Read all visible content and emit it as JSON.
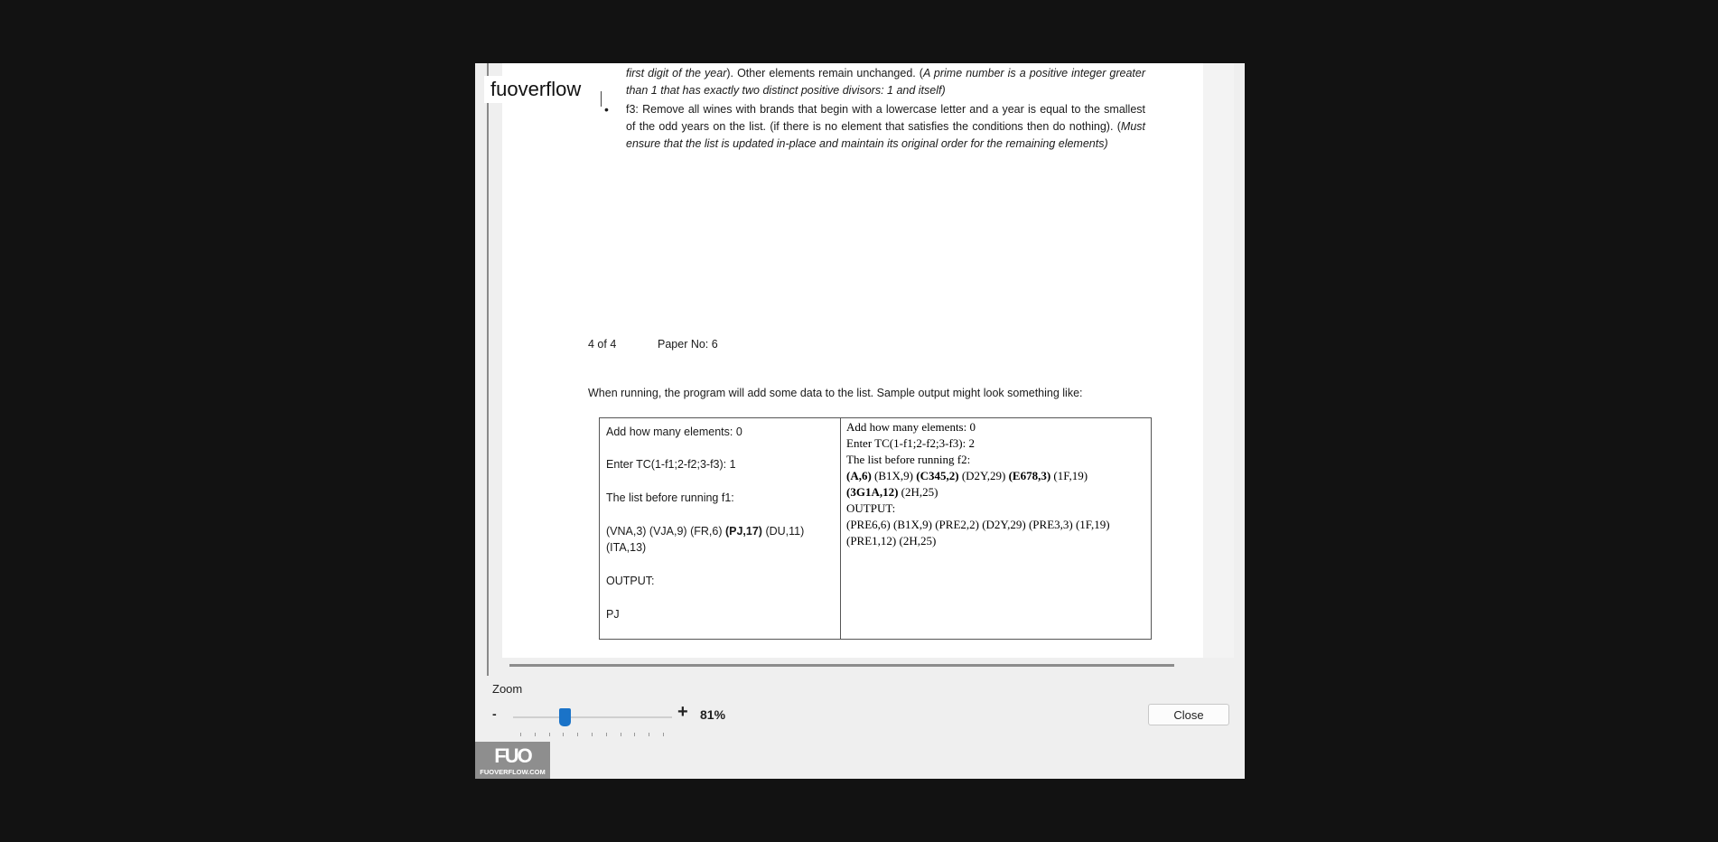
{
  "watermark": {
    "text": "fuoverflow"
  },
  "document": {
    "para1_parts": [
      {
        "text": "first digit of the year",
        "italic": true
      },
      {
        "text": "). Other elements remain unchanged. (",
        "italic": false
      },
      {
        "text": "A prime number is a positive integer greater than 1 that has exactly two distinct positive divisors: 1 and itself)",
        "italic": true
      }
    ],
    "bullet_f3_parts": [
      {
        "text": "f3: Remove all wines with brands that begin with a lowercase letter and a year is equal to the smallest of the odd years on the list. (if there is no element that satisfies the conditions then do nothing). (",
        "italic": false
      },
      {
        "text": "Must ensure that the list is updated in-place and maintain its original order for the remaining elements)",
        "italic": true
      }
    ],
    "bullet_symbol": "•",
    "page_indicator": "4 of 4",
    "paper_no": "Paper No: 6",
    "intro": "When running, the program will add  some data to the list. Sample output might look something like:",
    "left_cell": {
      "line1": "Add how many elements: 0",
      "line2": "Enter TC(1-f1;2-f2;3-f3): 1",
      "line3": "The list before running f1:",
      "line4_parts": [
        {
          "text": "(VNA,3) (VJA,9) (FR,6) ",
          "bold": false
        },
        {
          "text": "(PJ,17)",
          "bold": true
        },
        {
          "text": " (DU,11)",
          "bold": false
        }
      ],
      "line5": "(ITA,13)",
      "line6": "OUTPUT:",
      "line7": "PJ"
    },
    "right_cell": {
      "line1": "Add how many elements: 0",
      "line2": "Enter TC(1-f1;2-f2;3-f3): 2",
      "line3": "The list before running f2:",
      "line4_parts": [
        {
          "text": "(A,6)",
          "bold": true
        },
        {
          "text": " (B1X,9) ",
          "bold": false
        },
        {
          "text": "(C345,2)",
          "bold": true
        },
        {
          "text": " (D2Y,29) ",
          "bold": false
        },
        {
          "text": "(E678,3)",
          "bold": true
        },
        {
          "text": " (1F,19)",
          "bold": false
        }
      ],
      "line5_parts": [
        {
          "text": "(3G1A,12)",
          "bold": true
        },
        {
          "text": " (2H,25)",
          "bold": false
        }
      ],
      "line6": "OUTPUT:",
      "line7": "(PRE6,6) (B1X,9) (PRE2,2) (D2Y,29) (PRE3,3) (1F,19)",
      "line8": "(PRE1,12) (2H,25)"
    }
  },
  "zoom": {
    "label": "Zoom",
    "minus": "-",
    "plus": "+",
    "value": "81%",
    "level_percent": 81
  },
  "close_button": {
    "label": "Close"
  },
  "logo": {
    "mark": "FUO",
    "domain": "FUOVERFLOW.COM"
  },
  "colors": {
    "backdrop": "#121212",
    "dialog": "#efefef",
    "accent": "#1a73c8"
  }
}
